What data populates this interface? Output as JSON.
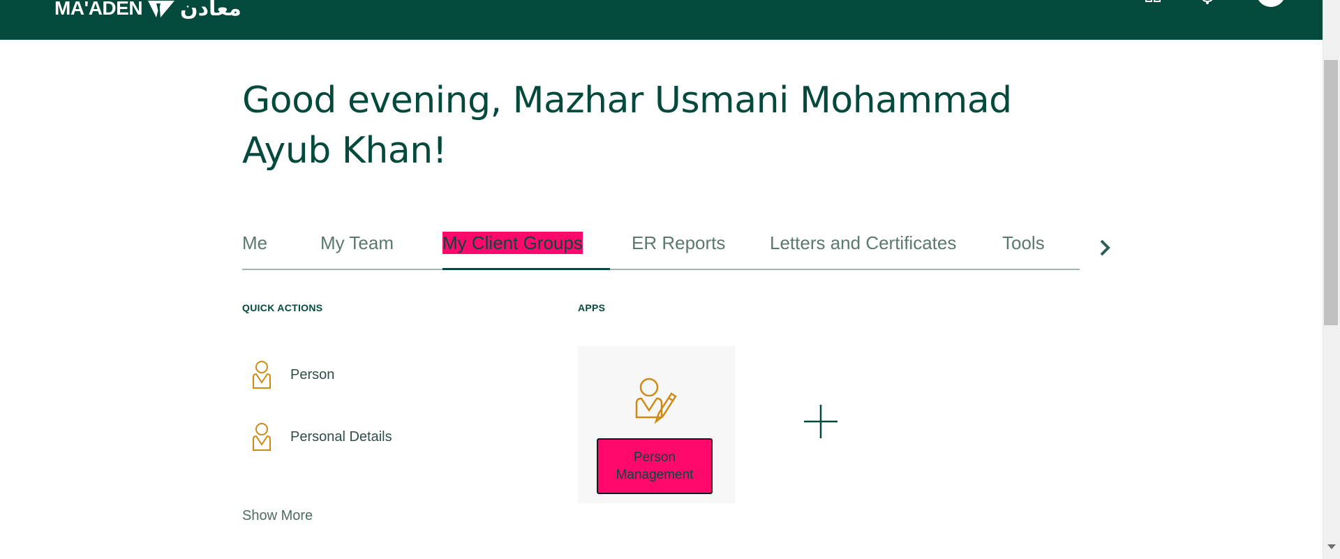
{
  "header": {
    "logo_latin": "MA'ADEN",
    "logo_arabic": "معادن",
    "icons": [
      "grid-icon",
      "notifications-icon",
      "user-avatar"
    ]
  },
  "greeting": "Good evening, Mazhar Usmani Mohammad Ayub Khan!",
  "tabs": [
    {
      "label": "Me"
    },
    {
      "label": "My Team"
    },
    {
      "label": "My Client Groups",
      "active": true
    },
    {
      "label": "ER Reports"
    },
    {
      "label": "Letters and Certificates"
    },
    {
      "label": "Tools"
    }
  ],
  "quick_actions": {
    "title": "QUICK ACTIONS",
    "items": [
      {
        "label": "Person",
        "icon": "person-icon"
      },
      {
        "label": "Personal Details",
        "icon": "person-icon"
      }
    ],
    "show_more": "Show More"
  },
  "apps": {
    "title": "APPS",
    "items": [
      {
        "label": "Person Management",
        "icon": "person-edit-icon"
      }
    ]
  },
  "colors": {
    "brand": "#044a3c",
    "highlight": "#ff0a6c",
    "icon_accent": "#d08a12"
  }
}
